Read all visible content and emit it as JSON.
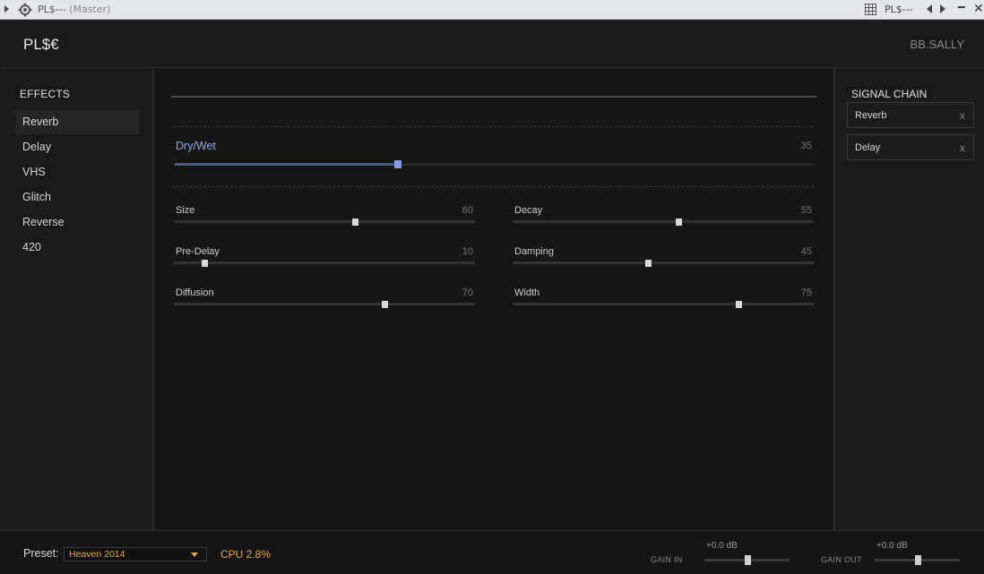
{
  "host": {
    "title": "PL$---",
    "subtitle": "(Master)",
    "plugin_name": "PL$---"
  },
  "header": {
    "app_title": "PL$€",
    "user": "BB.SALLY"
  },
  "sidebar": {
    "heading": "EFFECTS",
    "items": [
      {
        "label": "Reverb",
        "active": true
      },
      {
        "label": "Delay"
      },
      {
        "label": "VHS"
      },
      {
        "label": "Glitch"
      },
      {
        "label": "Reverse"
      },
      {
        "label": "420"
      }
    ]
  },
  "main": {
    "dry_wet": {
      "label": "Dry/Wet",
      "value": "35",
      "level": 35
    },
    "params": [
      {
        "label": "Size",
        "value": "60",
        "level": 60
      },
      {
        "label": "Decay",
        "value": "55",
        "level": 55
      },
      {
        "label": "Pre-Delay",
        "value": "10",
        "level": 10
      },
      {
        "label": "Damping",
        "value": "45",
        "level": 45
      },
      {
        "label": "Diffusion",
        "value": "70",
        "level": 70
      },
      {
        "label": "Width",
        "value": "75",
        "level": 75
      }
    ]
  },
  "chain": {
    "heading": "SIGNAL CHAIN",
    "items": [
      {
        "label": "Reverb",
        "remove": "x"
      },
      {
        "label": "Delay",
        "remove": "x"
      }
    ]
  },
  "footer": {
    "preset_label": "Preset:",
    "preset_value": "Heaven 2014",
    "cpu": "CPU 2.8%",
    "gain_in": {
      "label": "GAIN IN",
      "value": "+0.0 dB",
      "level": 50
    },
    "gain_out": {
      "label": "GAIN OUT",
      "value": "+0.0 dB",
      "level": 50
    }
  },
  "colors": {
    "accent_blue": "#7f9fe8",
    "accent_orange": "#e3a84a",
    "background": "#1a1a1a"
  },
  "icons": [
    "expand-arrow-icon",
    "gear-icon",
    "grid-icon",
    "prev-arrow-icon",
    "next-arrow-icon",
    "minimize-icon",
    "close-icon",
    "dropdown-caret-icon"
  ]
}
